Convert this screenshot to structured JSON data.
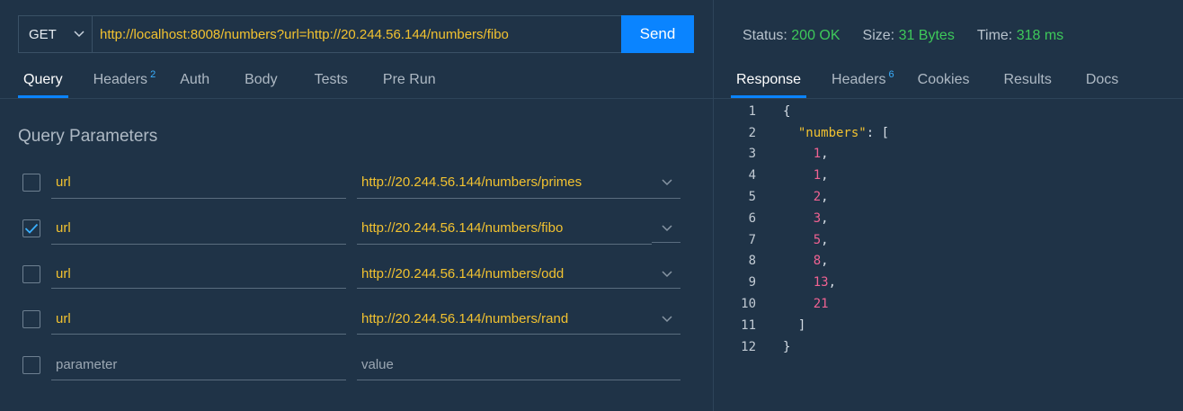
{
  "request": {
    "method": "GET",
    "url": "http://localhost:8008/numbers?url=http://20.244.56.144/numbers/fibo",
    "send_label": "Send"
  },
  "request_tabs": [
    {
      "label": "Query",
      "badge": ""
    },
    {
      "label": "Headers",
      "badge": "2"
    },
    {
      "label": "Auth",
      "badge": ""
    },
    {
      "label": "Body",
      "badge": ""
    },
    {
      "label": "Tests",
      "badge": ""
    },
    {
      "label": "Pre Run",
      "badge": ""
    }
  ],
  "query": {
    "title": "Query Parameters",
    "params": [
      {
        "checked": false,
        "key": "url",
        "value": "http://20.244.56.144/numbers/primes"
      },
      {
        "checked": true,
        "key": "url",
        "value": "http://20.244.56.144/numbers/fibo"
      },
      {
        "checked": false,
        "key": "url",
        "value": "http://20.244.56.144/numbers/odd"
      },
      {
        "checked": false,
        "key": "url",
        "value": "http://20.244.56.144/numbers/rand"
      }
    ],
    "new_param": {
      "key_placeholder": "parameter",
      "value_placeholder": "value"
    }
  },
  "response": {
    "status_label": "Status:",
    "status_value": "200 OK",
    "size_label": "Size:",
    "size_value": "31 Bytes",
    "time_label": "Time:",
    "time_value": "318 ms",
    "tabs": [
      {
        "label": "Response",
        "badge": ""
      },
      {
        "label": "Headers",
        "badge": "6"
      },
      {
        "label": "Cookies",
        "badge": ""
      },
      {
        "label": "Results",
        "badge": ""
      },
      {
        "label": "Docs",
        "badge": ""
      }
    ],
    "body_lines": [
      "{",
      "  \"numbers\": [",
      "    1,",
      "    1,",
      "    2,",
      "    3,",
      "    5,",
      "    8,",
      "    13,",
      "    21",
      "  ]",
      "}"
    ]
  },
  "colors": {
    "background": "#1f3347",
    "accent": "#0a84ff",
    "value_yellow": "#f2c230",
    "status_green": "#3ec95a",
    "number_pink": "#f06292"
  },
  "icons": {
    "method_dropdown": "chevron-down-icon",
    "checkbox_checked": "checkmark-icon",
    "value_dropdown": "chevron-down-icon"
  }
}
